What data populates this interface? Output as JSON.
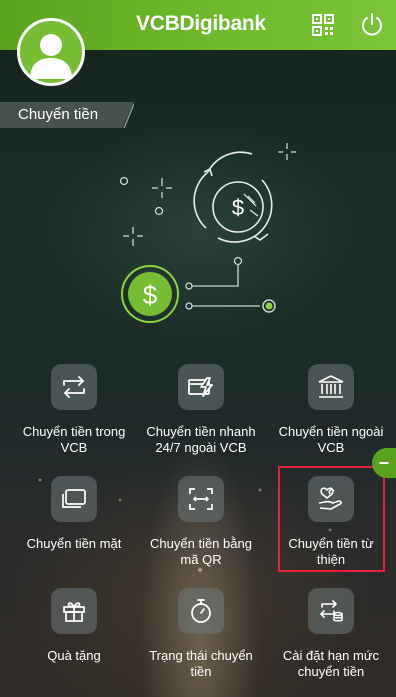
{
  "header": {
    "brand_vcb": "VCB",
    "brand_digibank": "Digibank",
    "qr_icon": "qr-code-icon",
    "power_icon": "power-icon"
  },
  "colors": {
    "brand_green": "#6cb82a",
    "highlight_red": "#e8213a"
  },
  "section": {
    "title": "Chuyển tiền"
  },
  "grid": {
    "items": [
      {
        "label_1": "Chuyển tiền trong",
        "label_2": "VCB",
        "icon": "transfer-arrows-icon"
      },
      {
        "label_1": "Chuyển tiền nhanh",
        "label_2": "24/7 ngoài VCB",
        "icon": "card-lightning-icon"
      },
      {
        "label_1": "Chuyển tiền ngoài",
        "label_2": "VCB",
        "icon": "bank-icon"
      },
      {
        "label_1": "Chuyển tiền mặt",
        "label_2": "",
        "icon": "cash-transfer-icon"
      },
      {
        "label_1": "Chuyển tiền bằng",
        "label_2": "mã QR",
        "icon": "qr-scan-icon"
      },
      {
        "label_1": "Chuyển tiền từ",
        "label_2": "thiện",
        "icon": "charity-hands-icon"
      },
      {
        "label_1": "Quà tặng",
        "label_2": "",
        "icon": "gift-icon"
      },
      {
        "label_1": "Trạng thái chuyển",
        "label_2": "tiền",
        "icon": "timer-icon"
      },
      {
        "label_1": "Cài đặt hạn mức",
        "label_2": "chuyển tiền",
        "icon": "limit-settings-icon"
      }
    ]
  },
  "side_tab": {
    "label": "–"
  }
}
